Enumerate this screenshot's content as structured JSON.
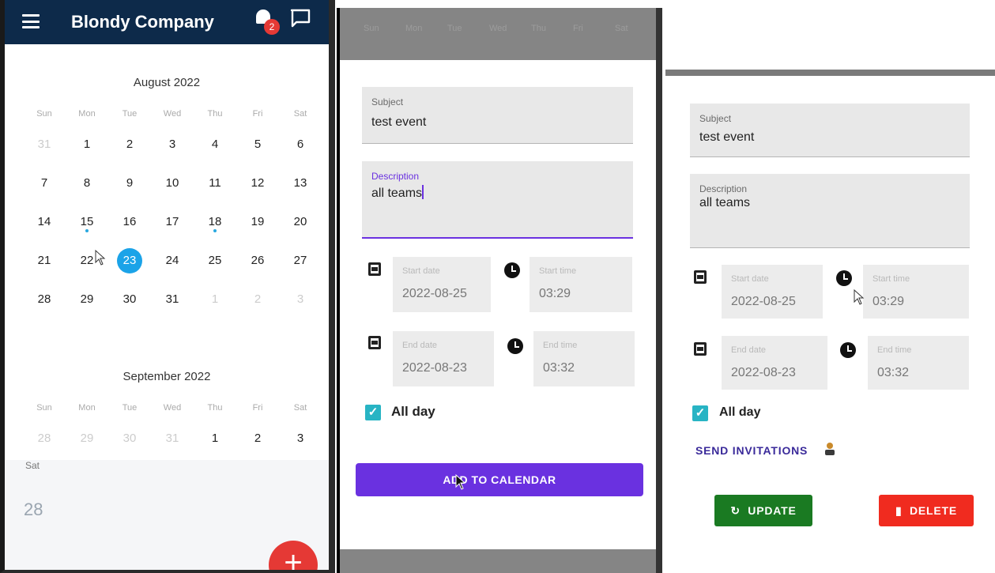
{
  "app": {
    "title": "Blondy Company",
    "notification_count": "2"
  },
  "calendar": {
    "weekdays": [
      "Sun",
      "Mon",
      "Tue",
      "Wed",
      "Thu",
      "Fri",
      "Sat"
    ],
    "august": {
      "title": "August 2022",
      "weeks": [
        [
          "31",
          "1",
          "2",
          "3",
          "4",
          "5",
          "6"
        ],
        [
          "7",
          "8",
          "9",
          "10",
          "11",
          "12",
          "13"
        ],
        [
          "14",
          "15",
          "16",
          "17",
          "18",
          "19",
          "20"
        ],
        [
          "21",
          "22",
          "23",
          "24",
          "25",
          "26",
          "27"
        ],
        [
          "28",
          "29",
          "30",
          "31",
          "1",
          "2",
          "3"
        ]
      ],
      "selected_day": "23"
    },
    "september": {
      "title": "September 2022",
      "weeks": [
        [
          "28",
          "29",
          "30",
          "31",
          "1",
          "2",
          "3"
        ]
      ]
    },
    "day_view": {
      "weekday": "Sat",
      "day": "28"
    },
    "fab_label": "+"
  },
  "add_form": {
    "top_weekdays": [
      "Sun",
      "Mon",
      "Tue",
      "Wed",
      "Thu",
      "Fri",
      "Sat"
    ],
    "subject_label": "Subject",
    "subject_value": "test event",
    "description_label": "Description",
    "description_value": "all teams",
    "start_date_label": "Start date",
    "start_date_value": "2022-08-25",
    "start_time_label": "Start time",
    "start_time_value": "03:29",
    "end_date_label": "End date",
    "end_date_value": "2022-08-23",
    "end_time_label": "End time",
    "end_time_value": "03:32",
    "all_day_label": "All day",
    "add_button": "ADD TO CALENDAR"
  },
  "edit_form": {
    "subject_label": "Subject",
    "subject_value": "test event",
    "description_label": "Description",
    "description_value": "all teams",
    "start_date_label": "Start date",
    "start_date_value": "2022-08-25",
    "start_time_label": "Start time",
    "start_time_value": "03:29",
    "end_date_label": "End date",
    "end_date_value": "2022-08-23",
    "end_time_label": "End time",
    "end_time_value": "03:32",
    "all_day_label": "All day",
    "send_invitations": "SEND INVITATIONS",
    "update_button": "UPDATE",
    "delete_button": "DELETE"
  },
  "colors": {
    "appbar": "#0d2a4a",
    "accent_purple": "#6a31e0",
    "today_blue": "#1ba3e8",
    "checkbox": "#28b4c4",
    "update_green": "#1a7a22",
    "delete_red": "#f02b1f"
  }
}
